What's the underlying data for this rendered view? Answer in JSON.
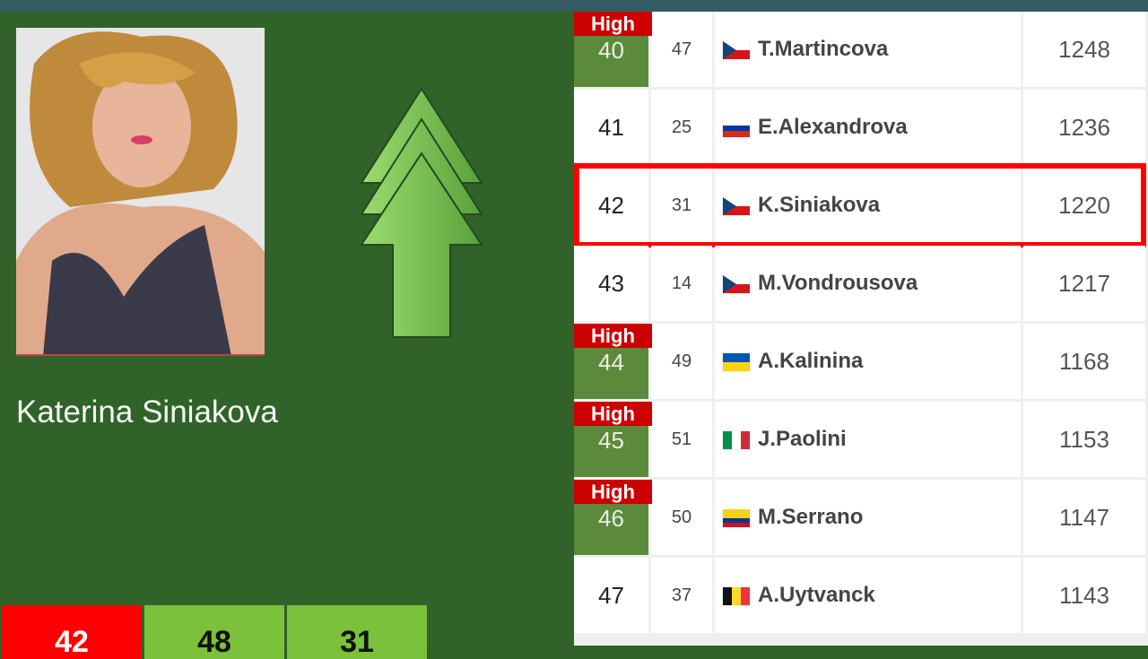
{
  "player": {
    "name": "Katerina Siniakova",
    "photo_alt": "player-photo"
  },
  "trend_icon": "triple-up-arrow-icon",
  "stats": [
    {
      "value": "42",
      "color": "#ff0000"
    },
    {
      "value": "48",
      "color": "#7bc13b"
    },
    {
      "value": "31",
      "color": "#7bc13b"
    }
  ],
  "colors": {
    "highlight_border": "#ff0000",
    "high_badge": "#cc0000",
    "high_cell": "#5b8a3c",
    "panel_bg": "#31622a"
  },
  "rankings": [
    {
      "rank": "40",
      "prev": "47",
      "flag": "czech",
      "name": "T.Martincova",
      "points": "1248",
      "high": true,
      "badge": "High"
    },
    {
      "rank": "41",
      "prev": "25",
      "flag": "russia",
      "name": "E.Alexandrova",
      "points": "1236",
      "high": false
    },
    {
      "rank": "42",
      "prev": "31",
      "flag": "czech",
      "name": "K.Siniakova",
      "points": "1220",
      "high": false,
      "highlighted": true
    },
    {
      "rank": "43",
      "prev": "14",
      "flag": "czech",
      "name": "M.Vondrousova",
      "points": "1217",
      "high": false
    },
    {
      "rank": "44",
      "prev": "49",
      "flag": "ukraine",
      "name": "A.Kalinina",
      "points": "1168",
      "high": true,
      "badge": "High"
    },
    {
      "rank": "45",
      "prev": "51",
      "flag": "italy",
      "name": "J.Paolini",
      "points": "1153",
      "high": true,
      "badge": "High"
    },
    {
      "rank": "46",
      "prev": "50",
      "flag": "colombia",
      "name": "M.Serrano",
      "points": "1147",
      "high": true,
      "badge": "High"
    },
    {
      "rank": "47",
      "prev": "37",
      "flag": "belgium",
      "name": "A.Uytvanck",
      "points": "1143",
      "high": false
    }
  ]
}
